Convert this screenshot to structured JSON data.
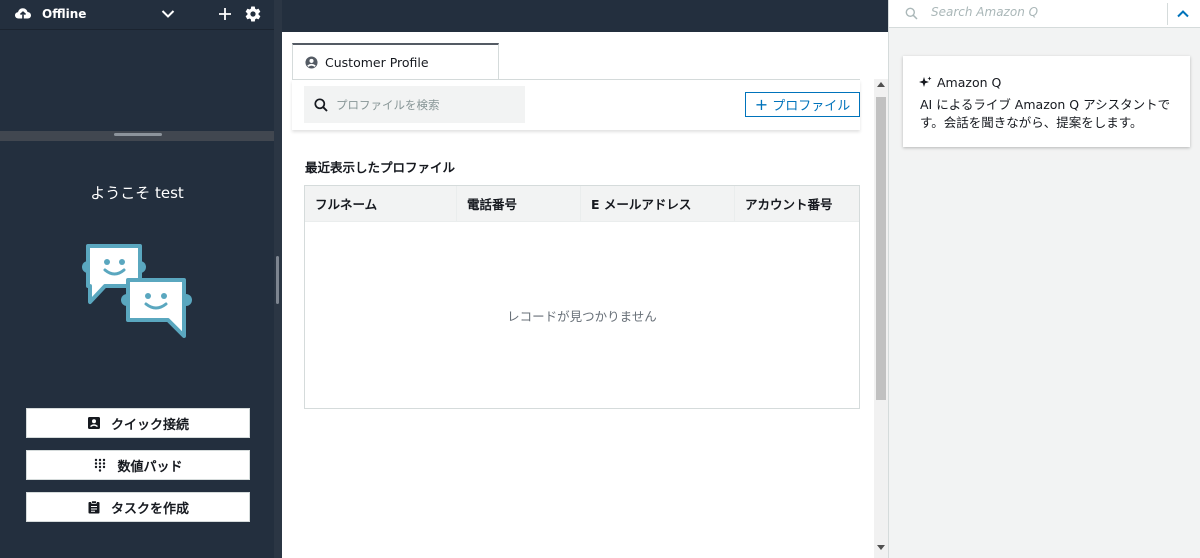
{
  "ccp": {
    "status": "Offline",
    "welcome": "ようこそ test",
    "buttons": {
      "quick_connect": "クイック接続",
      "number_pad": "数値パッド",
      "create_task": "タスクを作成"
    }
  },
  "tab": {
    "label": "Customer Profile"
  },
  "profile": {
    "search_placeholder": "プロファイルを検索",
    "add_button": "プロファイル",
    "section_title": "最近表示したプロファイル",
    "columns": [
      "フルネーム",
      "電話番号",
      "E メールアドレス",
      "アカウント番号"
    ],
    "empty_message": "レコードが見つかりません"
  },
  "amazon_q": {
    "search_placeholder": "Search Amazon Q",
    "title": "Amazon Q",
    "description": "AI によるライブ Amazon Q アシスタントです。会話を聞きながら、提案をします。"
  },
  "colors": {
    "ccp_background": "#232f3e",
    "accent_blue": "#0073bb",
    "q_blue": "#0073bb",
    "illustration_blue": "#5aa7bf"
  }
}
